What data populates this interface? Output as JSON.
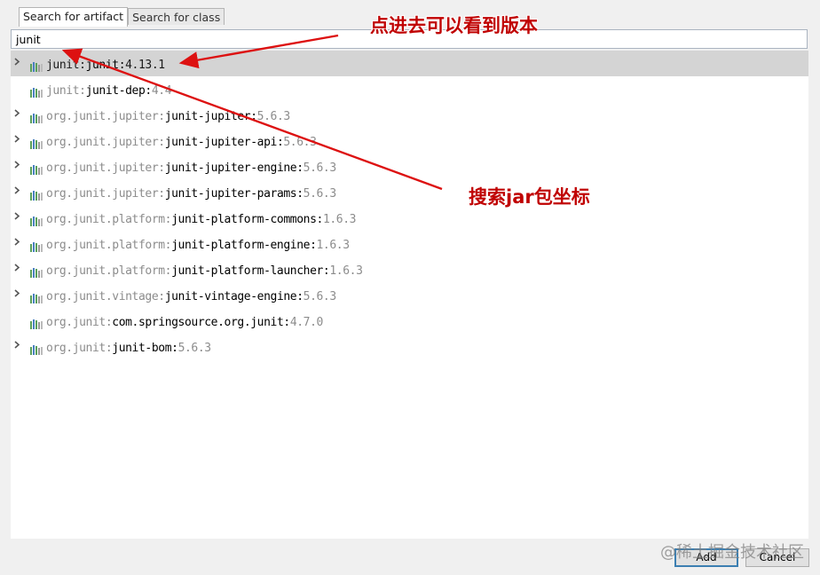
{
  "tabs": [
    {
      "label": "Search for artifact"
    },
    {
      "label": "Search for class"
    }
  ],
  "search": {
    "value": "junit"
  },
  "results": [
    {
      "group": "junit:",
      "artifact": "junit:",
      "version": "4.13.1",
      "expandable": true,
      "selected": true
    },
    {
      "group": "junit:",
      "artifact": "junit-dep:",
      "version": "4.4",
      "expandable": false,
      "selected": false
    },
    {
      "group": "org.junit.jupiter:",
      "artifact": "junit-jupiter:",
      "version": "5.6.3",
      "expandable": true,
      "selected": false
    },
    {
      "group": "org.junit.jupiter:",
      "artifact": "junit-jupiter-api:",
      "version": "5.6.3",
      "expandable": true,
      "selected": false
    },
    {
      "group": "org.junit.jupiter:",
      "artifact": "junit-jupiter-engine:",
      "version": "5.6.3",
      "expandable": true,
      "selected": false
    },
    {
      "group": "org.junit.jupiter:",
      "artifact": "junit-jupiter-params:",
      "version": "5.6.3",
      "expandable": true,
      "selected": false
    },
    {
      "group": "org.junit.platform:",
      "artifact": "junit-platform-commons:",
      "version": "1.6.3",
      "expandable": true,
      "selected": false
    },
    {
      "group": "org.junit.platform:",
      "artifact": "junit-platform-engine:",
      "version": "1.6.3",
      "expandable": true,
      "selected": false
    },
    {
      "group": "org.junit.platform:",
      "artifact": "junit-platform-launcher:",
      "version": "1.6.3",
      "expandable": true,
      "selected": false
    },
    {
      "group": "org.junit.vintage:",
      "artifact": "junit-vintage-engine:",
      "version": "5.6.3",
      "expandable": true,
      "selected": false
    },
    {
      "group": "org.junit:",
      "artifact": "com.springsource.org.junit:",
      "version": "4.7.0",
      "expandable": false,
      "selected": false
    },
    {
      "group": "org.junit:",
      "artifact": "junit-bom:",
      "version": "5.6.3",
      "expandable": true,
      "selected": false
    }
  ],
  "annotations": {
    "top": "点进去可以看到版本",
    "middle": "搜索jar包坐标"
  },
  "buttons": {
    "add": "Add",
    "cancel": "Cancel"
  },
  "watermark": "@稀土掘金技术社区",
  "colors": {
    "annotation": "#c00000",
    "selection": "#d4d4d4",
    "icon_green": "#5aa05a",
    "icon_blue": "#4a80c0"
  }
}
